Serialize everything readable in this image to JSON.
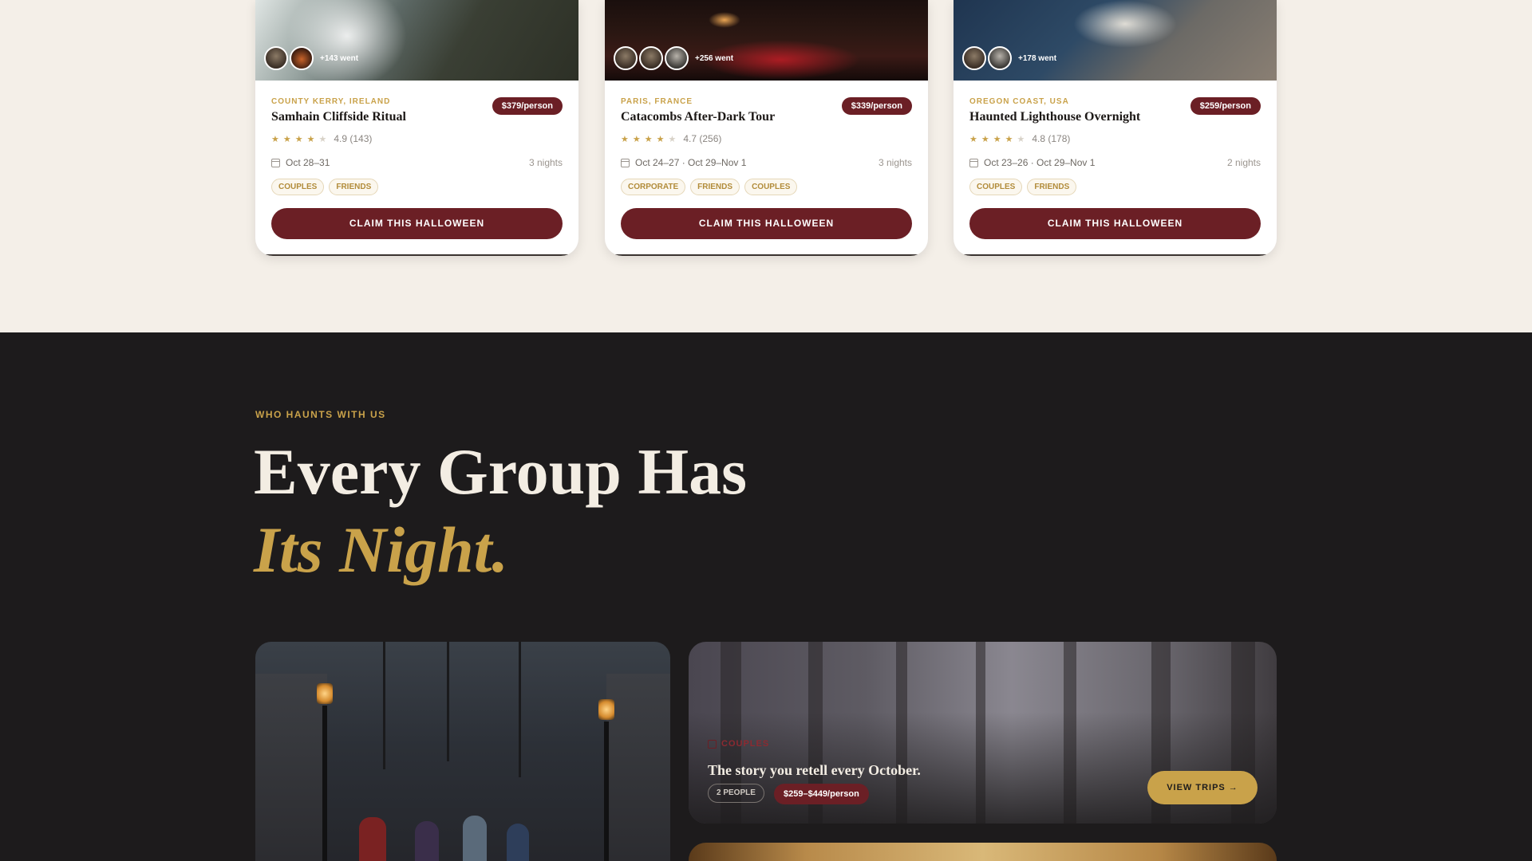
{
  "trips": [
    {
      "went": "+143 went",
      "location": "COUNTY KERRY, IRELAND",
      "price": "$379/person",
      "title": "Samhain Cliffside Ritual",
      "stars": "★★★★",
      "stars_off": "★",
      "rating": "4.9 (143)",
      "dates": "Oct 28–31",
      "nights": "3 nights",
      "tags": [
        "COUPLES",
        "FRIENDS"
      ],
      "cta": "CLAIM THIS HALLOWEEN"
    },
    {
      "went": "+256 went",
      "location": "PARIS, FRANCE",
      "price": "$339/person",
      "title": "Catacombs After-Dark Tour",
      "stars": "★★★★",
      "stars_off": "★",
      "rating": "4.7 (256)",
      "dates": "Oct 24–27 · Oct 29–Nov 1",
      "nights": "3 nights",
      "tags": [
        "CORPORATE",
        "FRIENDS",
        "COUPLES"
      ],
      "cta": "CLAIM THIS HALLOWEEN"
    },
    {
      "went": "+178 went",
      "location": "OREGON COAST, USA",
      "price": "$259/person",
      "title": "Haunted Lighthouse Overnight",
      "stars": "★★★★",
      "stars_off": "★",
      "rating": "4.8 (178)",
      "dates": "Oct 23–26 · Oct 29–Nov 1",
      "nights": "2 nights",
      "tags": [
        "COUPLES",
        "FRIENDS"
      ],
      "cta": "CLAIM THIS HALLOWEEN"
    }
  ],
  "groups": {
    "eyebrow": "WHO HAUNTS WITH US",
    "heading_line1": "Every Group Has",
    "heading_line2": "Its Night.",
    "feature": {
      "category": "COUPLES",
      "story": "The story you retell every October.",
      "people": "2 PEOPLE",
      "price_range": "$259–$449/person",
      "button": "VIEW TRIPS →"
    }
  },
  "colors": {
    "accent_gold": "#c9a24a",
    "accent_burgundy": "#6b1f25",
    "dark_bg": "#1d1b1c",
    "light_bg": "#f4efe8"
  }
}
